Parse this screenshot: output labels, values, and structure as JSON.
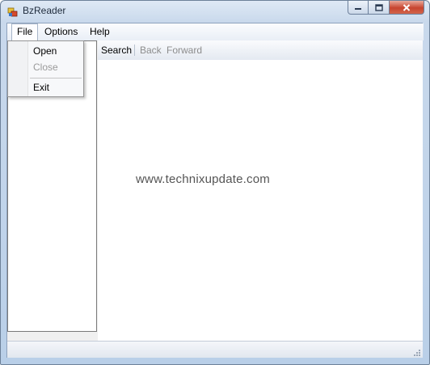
{
  "window": {
    "title": "BzReader",
    "icons": {
      "app": "bzreader-app-icon",
      "minimize": "minimize-icon",
      "maximize": "maximize-icon",
      "close": "close-icon"
    }
  },
  "menubar": {
    "items": [
      {
        "label": "File"
      },
      {
        "label": "Options"
      },
      {
        "label": "Help"
      }
    ]
  },
  "file_menu": {
    "items": [
      {
        "label": "Open",
        "enabled": true
      },
      {
        "label": "Close",
        "enabled": false
      },
      {
        "label": "Exit",
        "enabled": true
      }
    ]
  },
  "toolbar": {
    "search_label": "Search",
    "back_label": "Back",
    "forward_label": "Forward"
  },
  "content": {
    "watermark": "www.technixupdate.com"
  },
  "colors": {
    "title_bar": "#c9d9ec",
    "close_button": "#c7452f",
    "disabled_text": "#8d8d8d"
  }
}
